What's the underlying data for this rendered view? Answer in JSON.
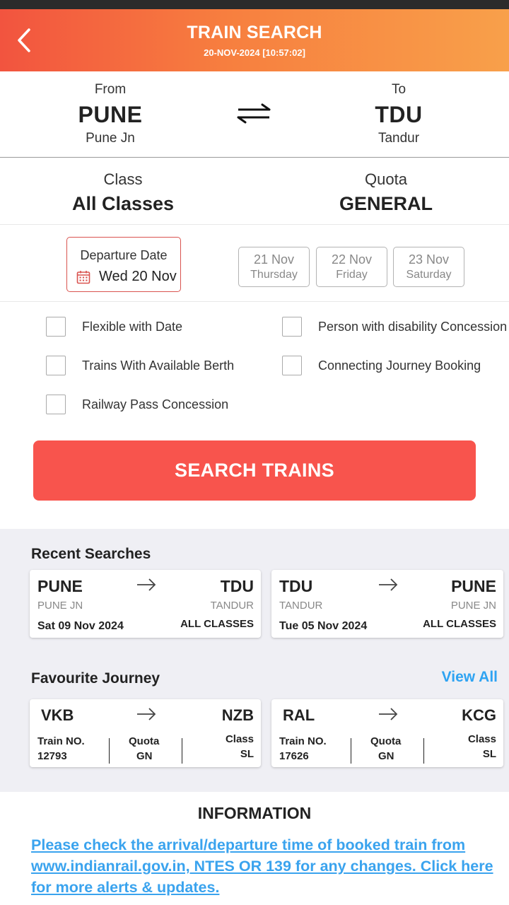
{
  "header": {
    "title": "TRAIN SEARCH",
    "datetime": "20-NOV-2024 [10:57:02]",
    "gradient_start": "#f2543f",
    "gradient_end": "#f8a04a"
  },
  "journey": {
    "from": {
      "label": "From",
      "code": "PUNE",
      "name": "Pune Jn"
    },
    "to": {
      "label": "To",
      "code": "TDU",
      "name": "Tandur"
    },
    "swap_icon": "swap-arrows-icon"
  },
  "class": {
    "label": "Class",
    "value": "All Classes"
  },
  "quota": {
    "label": "Quota",
    "value": "GENERAL"
  },
  "departure": {
    "label": "Departure Date",
    "value": "Wed 20 Nov",
    "icon": "calendar-icon"
  },
  "date_options": [
    {
      "date": "21 Nov",
      "day": "Thursday"
    },
    {
      "date": "22 Nov",
      "day": "Friday"
    },
    {
      "date": "23 Nov",
      "day": "Saturday"
    }
  ],
  "options": [
    {
      "label": "Flexible with Date",
      "checked": false
    },
    {
      "label": "Person with disability Concession",
      "checked": false
    },
    {
      "label": "Trains With Available Berth",
      "checked": false
    },
    {
      "label": "Connecting Journey Booking",
      "checked": false
    },
    {
      "label": "Railway Pass Concession",
      "checked": false
    }
  ],
  "search_button": {
    "label": "SEARCH TRAINS",
    "color": "#f8544d"
  },
  "recent": {
    "title": "Recent Searches",
    "items": [
      {
        "from": "PUNE",
        "from_name": "PUNE JN",
        "to": "TDU",
        "to_name": "TANDUR",
        "date": "Sat 09 Nov 2024",
        "class": "ALL CLASSES"
      },
      {
        "from": "TDU",
        "from_name": "TANDUR",
        "to": "PUNE",
        "to_name": "PUNE JN",
        "date": "Tue 05 Nov 2024",
        "class": "ALL CLASSES"
      }
    ]
  },
  "favourite": {
    "title": "Favourite Journey",
    "view_all": "View All",
    "items": [
      {
        "from": "VKB",
        "to": "NZB",
        "train_label": "Train NO.",
        "train_no": "12793",
        "quota_label": "Quota",
        "quota": "GN",
        "class_label": "Class",
        "class": "SL"
      },
      {
        "from": "RAL",
        "to": "KCG",
        "train_label": "Train NO.",
        "train_no": "17626",
        "quota_label": "Quota",
        "quota": "GN",
        "class_label": "Class",
        "class": "SL"
      }
    ]
  },
  "information": {
    "title": "INFORMATION",
    "text": "Please check the arrival/departure time of booked train from www.indianrail.gov.in, NTES OR 139 for any changes. Click here for more alerts & updates.",
    "link_color": "#3aa3ee"
  }
}
